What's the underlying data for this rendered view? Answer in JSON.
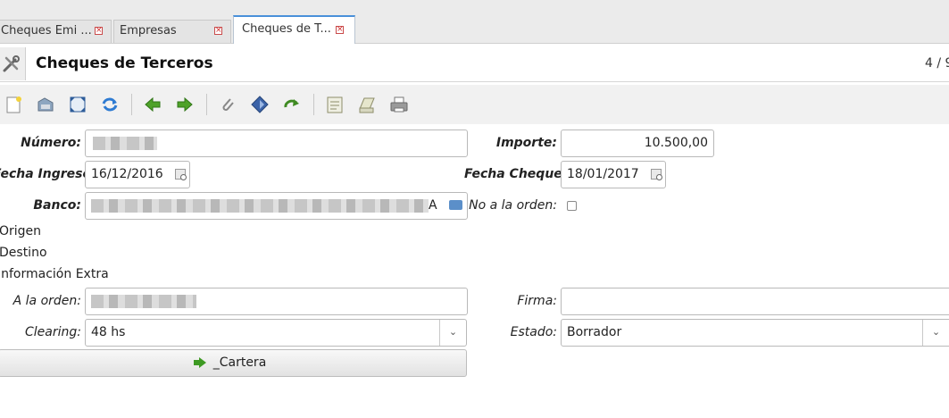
{
  "tabs": [
    {
      "label": "Cheques Emi ...",
      "active": false
    },
    {
      "label": "Empresas",
      "active": false
    },
    {
      "label": "Cheques de T...",
      "active": true
    }
  ],
  "window": {
    "title": "Cheques de Terceros",
    "pager": "4 / 9"
  },
  "toolbar": {
    "icons": [
      "new-icon",
      "save-icon",
      "expand-icon",
      "refresh-icon",
      "previous-icon",
      "next-icon",
      "attach-icon",
      "zoom-icon",
      "redo-icon",
      "report-icon",
      "print-preview-icon",
      "print-icon"
    ]
  },
  "form": {
    "numero": {
      "label": "Número:",
      "value": ""
    },
    "importe": {
      "label": "Importe:",
      "value": "10.500,00"
    },
    "fecha_ingreso": {
      "label": "Fecha Ingreso:",
      "value": "16/12/2016"
    },
    "fecha_cheque": {
      "label": "Fecha Cheque:",
      "value": "18/01/2017"
    },
    "banco": {
      "label": "Banco:",
      "value_suffix": "A"
    },
    "no_a_la_orden": {
      "label": "No a la orden:",
      "checked": false
    },
    "sections": {
      "origen": "Origen",
      "destino": "Destino",
      "info_extra": "Información Extra"
    },
    "a_la_orden": {
      "label": "A la orden:",
      "value": ""
    },
    "firma": {
      "label": "Firma:",
      "value": ""
    },
    "clearing": {
      "label": "Clearing:",
      "value": "48 hs"
    },
    "estado": {
      "label": "Estado:",
      "value": "Borrador"
    },
    "cartera_button": "_Cartera"
  },
  "colors": {
    "accent": "#4a90d9",
    "action_green": "#3e9a23",
    "close_red": "#d0302f"
  }
}
